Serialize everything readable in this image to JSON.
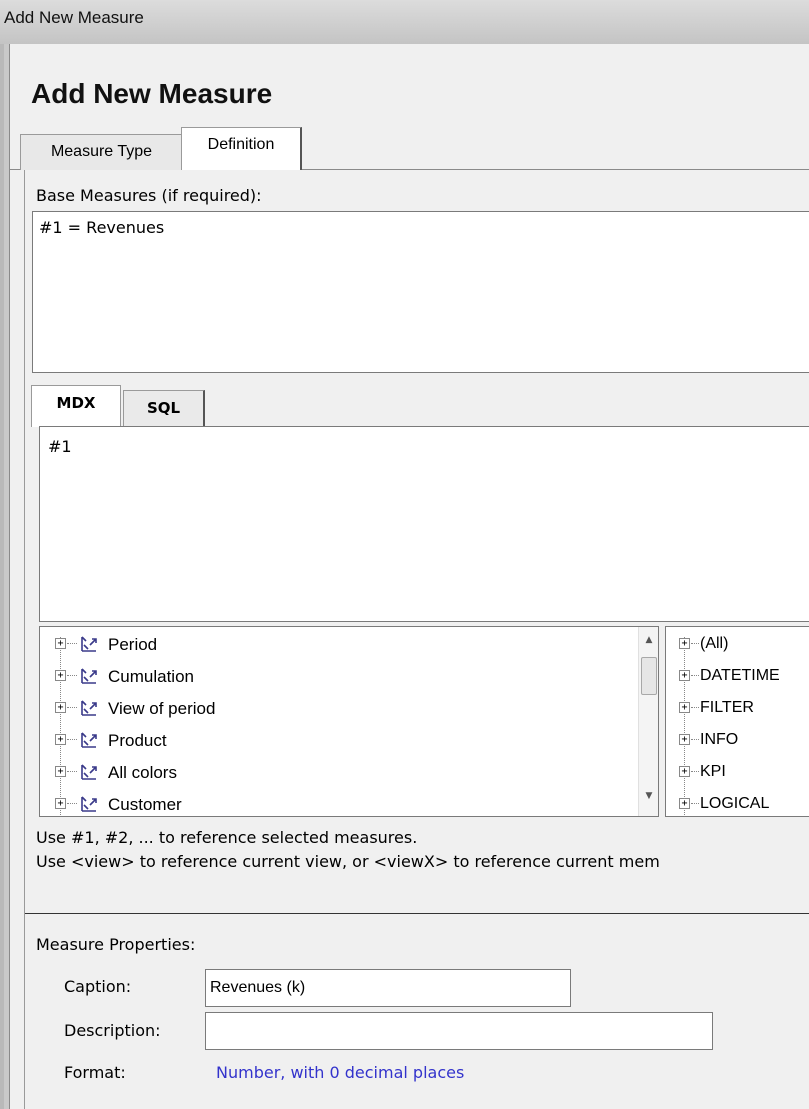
{
  "window": {
    "title": "Add New Measure"
  },
  "dialog": {
    "heading": "Add New Measure",
    "tabs": [
      {
        "label": "Measure Type"
      },
      {
        "label": "Definition"
      }
    ]
  },
  "definition": {
    "base_measures_label": "Base Measures (if required):",
    "base_measures_value": "#1 = Revenues",
    "editor_tabs": [
      {
        "label": "MDX"
      },
      {
        "label": "SQL"
      }
    ],
    "editor_value": "#1",
    "dimension_tree": [
      {
        "label": "Period",
        "icon": "hierarchy-icon"
      },
      {
        "label": "Cumulation",
        "icon": "hierarchy-icon"
      },
      {
        "label": "View of period",
        "icon": "hierarchy-icon"
      },
      {
        "label": "Product",
        "icon": "hierarchy-icon"
      },
      {
        "label": "All colors",
        "icon": "hierarchy-icon"
      },
      {
        "label": "Customer",
        "icon": "hierarchy-icon"
      }
    ],
    "function_tree": [
      {
        "label": "(All)"
      },
      {
        "label": "DATETIME"
      },
      {
        "label": "FILTER"
      },
      {
        "label": "INFO"
      },
      {
        "label": "KPI"
      },
      {
        "label": "LOGICAL"
      }
    ],
    "hint_line1": "Use #1, #2, ... to reference selected measures.",
    "hint_line2": "Use <view> to reference current view, or <viewX> to reference current mem"
  },
  "properties": {
    "section_label": "Measure Properties:",
    "caption_label": "Caption:",
    "caption_value": "Revenues (k)",
    "description_label": "Description:",
    "description_value": "",
    "format_label": "Format:",
    "format_value": "Number, with 0 decimal places"
  },
  "colors": {
    "link": "#3333cc",
    "tree_icon": "#3a3a8a"
  }
}
